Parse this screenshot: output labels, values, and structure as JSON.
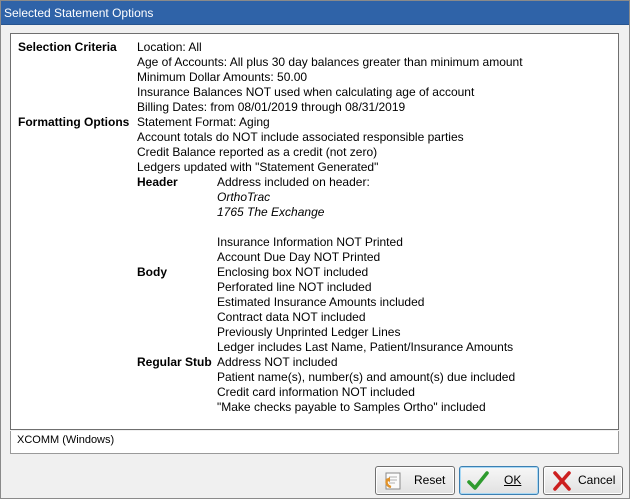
{
  "window": {
    "title": "Selected Statement Options"
  },
  "selection_criteria": {
    "label": "Selection Criteria",
    "lines": [
      "Location: All",
      "Age of Accounts: All plus 30 day balances greater than minimum amount",
      "Minimum Dollar Amounts: 50.00",
      "Insurance Balances NOT used when calculating age of account",
      "Billing Dates: from 08/01/2019 through 08/31/2019"
    ]
  },
  "formatting_options": {
    "label": "Formatting Options",
    "lines": [
      "Statement Format: Aging",
      "Account totals do NOT include associated responsible parties",
      "Credit Balance reported as a credit (not zero)",
      "Ledgers updated with \"Statement Generated\""
    ]
  },
  "header": {
    "label": "Header",
    "address_line": "Address included on header:",
    "address": [
      "OrthoTrac",
      "1765 The Exchange"
    ],
    "lines": [
      "Insurance Information NOT Printed",
      "Account Due Day NOT Printed"
    ]
  },
  "body": {
    "label": "Body",
    "lines": [
      "Enclosing box NOT included",
      "Perforated line NOT included",
      "Estimated Insurance Amounts included",
      "Contract data NOT included",
      "Previously Unprinted Ledger Lines",
      "Ledger includes Last Name, Patient/Insurance Amounts"
    ]
  },
  "regular_stub": {
    "label": "Regular Stub",
    "lines": [
      "Address NOT included",
      "Patient name(s), number(s) and amount(s) due included",
      "Credit card information NOT included",
      "\"Make checks payable to Samples Ortho\" included"
    ]
  },
  "status_bar": {
    "text": "XCOMM (Windows)"
  },
  "buttons": {
    "reset": "Reset",
    "ok": "OK",
    "cancel": "Cancel"
  },
  "colors": {
    "title_bar": "#2f63a8",
    "ok_check": "#2e9b2e",
    "cancel_x": "#cc1f1f"
  },
  "icons": {
    "reset": "reset-icon",
    "ok": "check-icon",
    "cancel": "x-icon"
  }
}
